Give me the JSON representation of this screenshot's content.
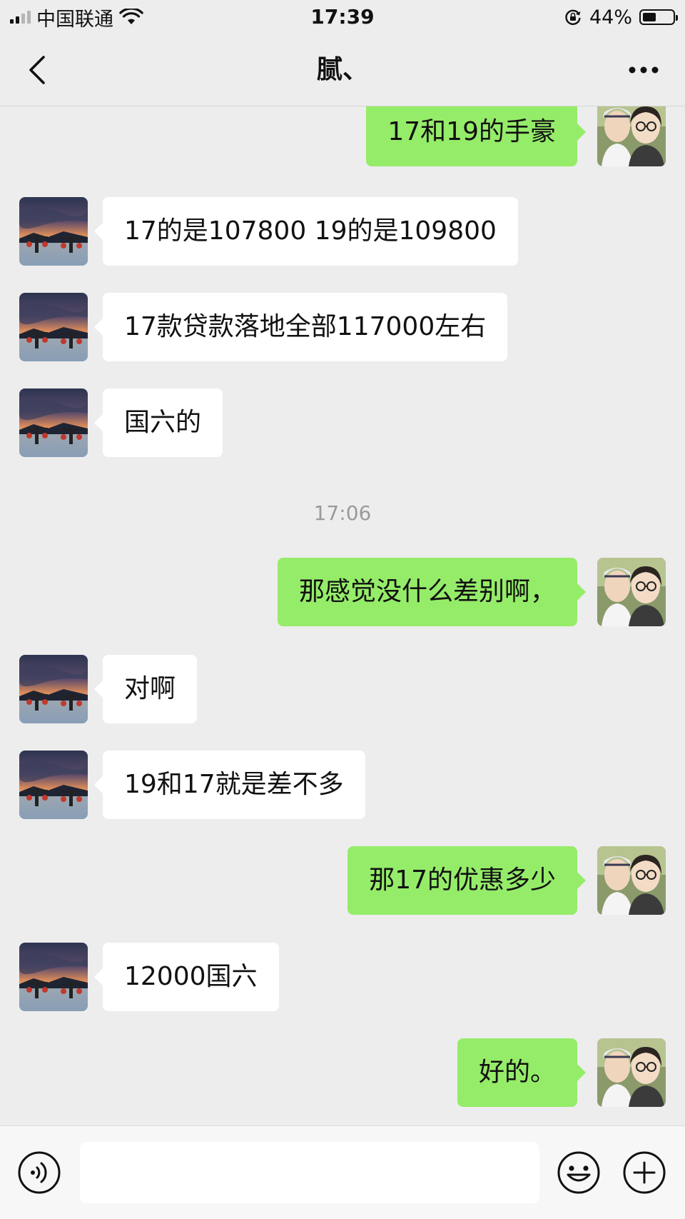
{
  "status_bar": {
    "carrier": "中国联通",
    "time": "17:39",
    "battery_percent_label": "44%",
    "battery_level": 0.44,
    "signal_bars_filled": 2,
    "signal_bars_total": 4
  },
  "nav": {
    "title": "腻、",
    "back_icon": "chevron-left-icon",
    "more_icon": "ellipsis-icon"
  },
  "messages": [
    {
      "side": "out",
      "text": "17和19的手豪"
    },
    {
      "side": "in",
      "text": "17的是107800 19的是109800"
    },
    {
      "side": "in",
      "text": "17款贷款落地全部117000左右"
    },
    {
      "side": "in",
      "text": "国六的"
    },
    {
      "type": "time",
      "text": "17:06"
    },
    {
      "side": "out",
      "text": "那感觉没什么差别啊，"
    },
    {
      "side": "in",
      "text": "对啊"
    },
    {
      "side": "in",
      "text": "19和17就是差不多"
    },
    {
      "side": "out",
      "text": "那17的优惠多少"
    },
    {
      "side": "in",
      "text": "12000国六"
    },
    {
      "side": "out",
      "text": "好的。"
    }
  ],
  "input_bar": {
    "placeholder": "",
    "voice_icon": "voice-icon",
    "emoji_icon": "emoji-icon",
    "plus_icon": "plus-circle-icon"
  },
  "colors": {
    "background": "#ededed",
    "outgoing_bubble": "#95ec69",
    "incoming_bubble": "#ffffff",
    "timestamp_text": "#9a9a9a"
  }
}
